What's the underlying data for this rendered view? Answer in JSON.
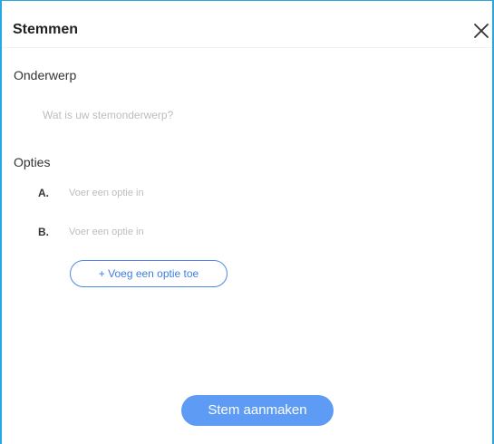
{
  "dialog": {
    "title": "Stemmen",
    "close_icon": "close-icon"
  },
  "subject": {
    "label": "Onderwerp",
    "placeholder": "Wat is uw stemonderwerp?",
    "value": ""
  },
  "options": {
    "label": "Opties",
    "items": [
      {
        "letter": "A.",
        "placeholder": "Voer een optie in",
        "value": ""
      },
      {
        "letter": "B.",
        "placeholder": "Voer een optie in",
        "value": ""
      }
    ],
    "add_label": "+ Voeg een optie toe"
  },
  "actions": {
    "create_label": "Stem aanmaken"
  },
  "colors": {
    "frame_border": "#2aa6e2",
    "accent": "#5e9bf5",
    "outline_button": "#4e88e8",
    "placeholder": "#bdbdbd"
  }
}
